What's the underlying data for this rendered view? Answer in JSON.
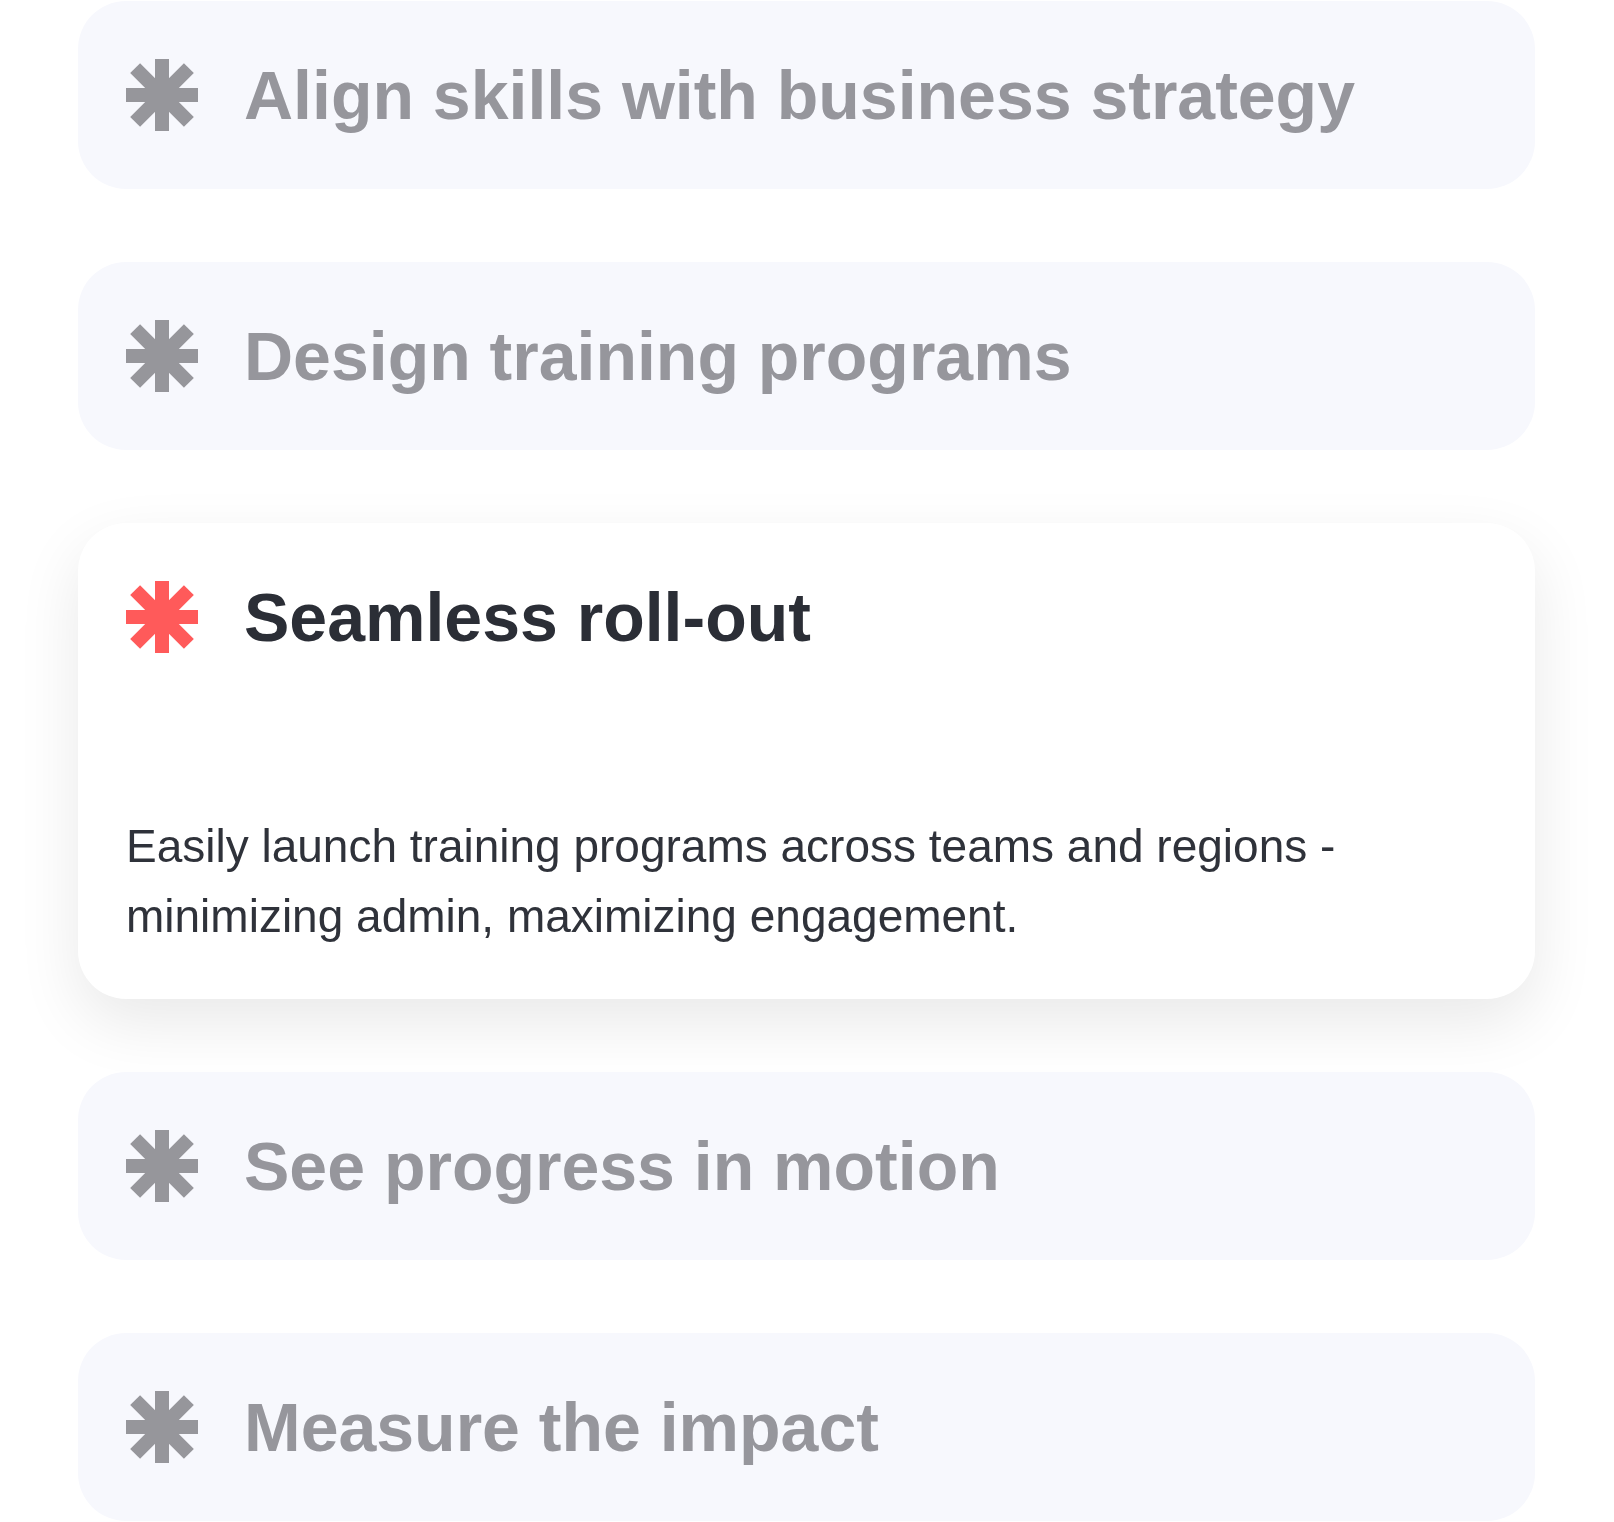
{
  "items": [
    {
      "title": "Align skills with business strategy",
      "expanded": false
    },
    {
      "title": "Design training programs",
      "expanded": false
    },
    {
      "title": "Seamless roll-out",
      "expanded": true,
      "description": "Easily launch training programs across teams and regions - minimizing admin, maximizing engagement."
    },
    {
      "title": "See progress in motion",
      "expanded": false
    },
    {
      "title": "Measure the impact",
      "expanded": false
    }
  ]
}
